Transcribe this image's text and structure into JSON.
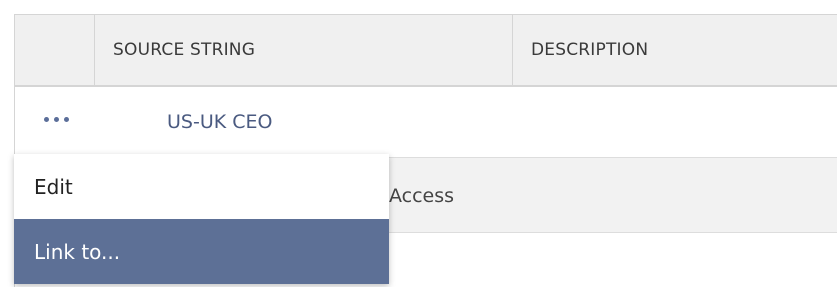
{
  "table": {
    "columns": [
      "SOURCE STRING",
      "DESCRIPTION"
    ],
    "rows": [
      {
        "source": "US-UK CEO"
      },
      {
        "source": "Access"
      }
    ]
  },
  "context_menu": {
    "items": [
      {
        "label": "Edit",
        "highlighted": false
      },
      {
        "label": "Link to...",
        "highlighted": true
      }
    ]
  },
  "colors": {
    "header_bg": "#f0f0f0",
    "menu_highlight": "#5d7096",
    "link_text": "#4a5a80",
    "dots": "#5b6e99"
  },
  "icons": {
    "row_actions": "more-horizontal-icon"
  }
}
